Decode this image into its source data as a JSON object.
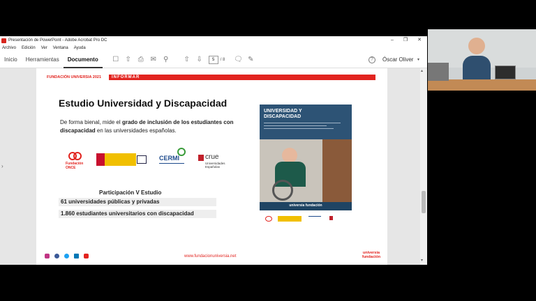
{
  "window": {
    "title": "Presentación de PowerPoint - Adobe Acrobat Pro DC",
    "controls": [
      "–",
      "❐",
      "✕"
    ]
  },
  "menu": [
    "Archivo",
    "Edición",
    "Ver",
    "Ventana",
    "Ayuda"
  ],
  "toolbar": {
    "tabs": [
      "Inicio",
      "Herramientas",
      "Documento"
    ],
    "page_current": "5",
    "page_total": "/ 8",
    "user": "Óscar Oliver",
    "help": "?"
  },
  "slide": {
    "brand": "FUNDACIÓN UNIVERSIA 2021",
    "section": "INFORMAR",
    "title": "Estudio Universidad y Discapacidad",
    "desc_pre": "De forma bienal, mide el ",
    "desc_bold": "grado de inclusión de los estudiantes con discapacidad",
    "desc_post": " en las universidades españolas.",
    "participation_heading": "Participación V Estudio",
    "stats": [
      "61 universidades públicas y privadas",
      "1.860 estudiantes universitarios con discapacidad"
    ],
    "footer_url": "www.fundacionuniversia.net",
    "footer_logo": "universia\nfundación",
    "logos": {
      "once": "Fundación ONCE",
      "crue": "crue",
      "crue_sub": "Universidades Españolas",
      "cermi": "CERMI"
    },
    "cover": {
      "title": "UNIVERSIDAD Y DISCAPACIDAD",
      "logo": "universia fundación"
    }
  },
  "colors": {
    "brand_red": "#e2241f",
    "stat_bg": "#eeeeee",
    "cover_bg": "#274d6b"
  }
}
